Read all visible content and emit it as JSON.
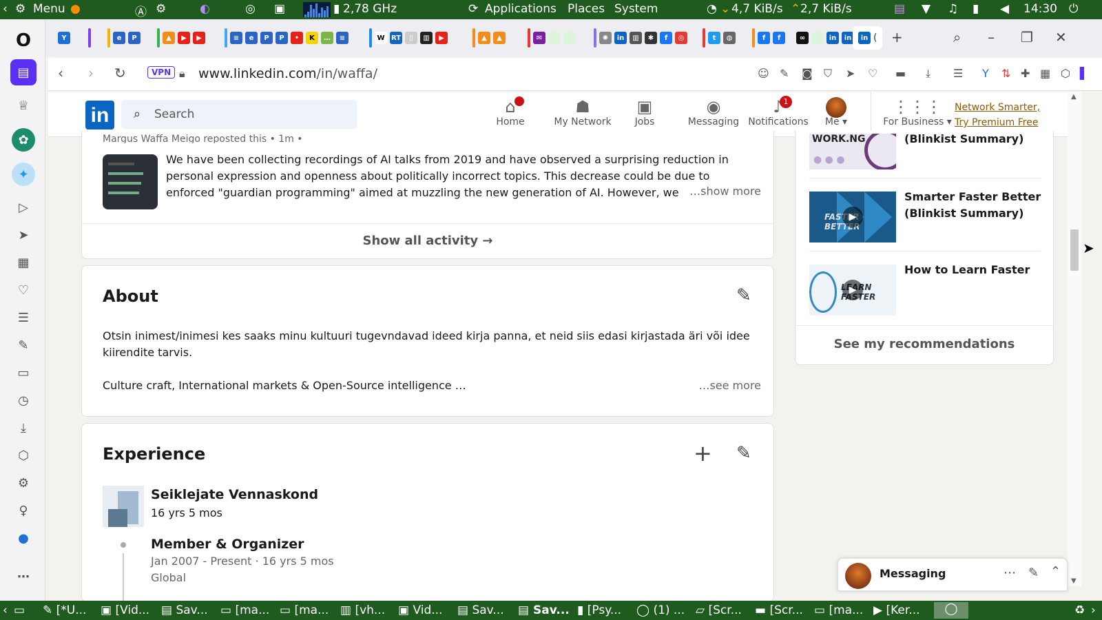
{
  "os_panel": {
    "menu_label": "Menu",
    "cpu_freq": "2,78 GHz",
    "menus": [
      "Applications",
      "Places",
      "System"
    ],
    "net_down": "4,7 KiB/s",
    "net_up": "2,7 KiB/s",
    "clock": "14:30"
  },
  "browser": {
    "vpn_label": "VPN",
    "url_host": "www.linkedin.com",
    "url_path": "/in/waffa/"
  },
  "linkedin_header": {
    "logo": "in",
    "search_placeholder": "Search",
    "nav": [
      {
        "label": "Home",
        "icon": "home-icon"
      },
      {
        "label": "My Network",
        "icon": "network-icon"
      },
      {
        "label": "Jobs",
        "icon": "briefcase-icon"
      },
      {
        "label": "Messaging",
        "icon": "chat-icon"
      },
      {
        "label": "Notifications",
        "icon": "bell-icon",
        "badge": "1"
      },
      {
        "label": "Me",
        "icon": "avatar"
      }
    ],
    "for_business": "For Business",
    "premium_line1": "Network Smarter,",
    "premium_line2": "Try Premium Free"
  },
  "activity": {
    "repost_header": "Margus Waffa Meigo reposted this • 1m •",
    "post_text": "We have been collecting recordings of AI talks from 2019 and have observed a surprising reduction in personal expression and openness about politically incorrect topics. This decrease could be due to enforced \"guardian programming\" aimed at muzzling the new generation of AI. However, we",
    "show_more": "…show more",
    "show_all": "Show all activity →"
  },
  "about": {
    "title": "About",
    "text": "Otsin inimest/inimesi kes saaks minu kultuuri tugevndavad ideed kirja panna, et neid siis edasi kirjastada äri või idee kiirendite tarvis.",
    "skills": "Culture craft, International markets & Open-Source intelligence …",
    "see_more": "…see more"
  },
  "experience": {
    "title": "Experience",
    "company": "Seiklejate Vennaskond",
    "company_duration": "16 yrs 5 mos",
    "role": "Member & Organizer",
    "role_dates": "Jan 2007 - Present · 16 yrs 5 mos",
    "location": "Global"
  },
  "recommendations": {
    "items": [
      {
        "title": "(Blinkist Summary)",
        "thumb_text": "WORK.NG"
      },
      {
        "title_line1": "Smarter Faster Better",
        "title_line2": "(Blinkist Summary)",
        "thumb_text": "FASTER BETTER"
      },
      {
        "title": "How to Learn Faster",
        "thumb_text": "LEARN FASTER"
      }
    ],
    "see_my": "See my recommendations"
  },
  "messaging_widget": {
    "label": "Messaging"
  },
  "taskbar": {
    "items": [
      "[*U...",
      "[Vid...",
      "Sav...",
      "[ma...",
      "[ma...",
      "[vh...",
      "Vid...",
      "Sav...",
      "Sav...",
      "[Psy...",
      "(1) ...",
      "[Scr...",
      "[Scr...",
      "[ma...",
      "[Ker..."
    ]
  },
  "colors": {
    "linkedin_blue": "#0a66c2",
    "os_panel": "#1f5a1f",
    "badge_red": "#cc1016",
    "premium_gold": "#915907"
  }
}
